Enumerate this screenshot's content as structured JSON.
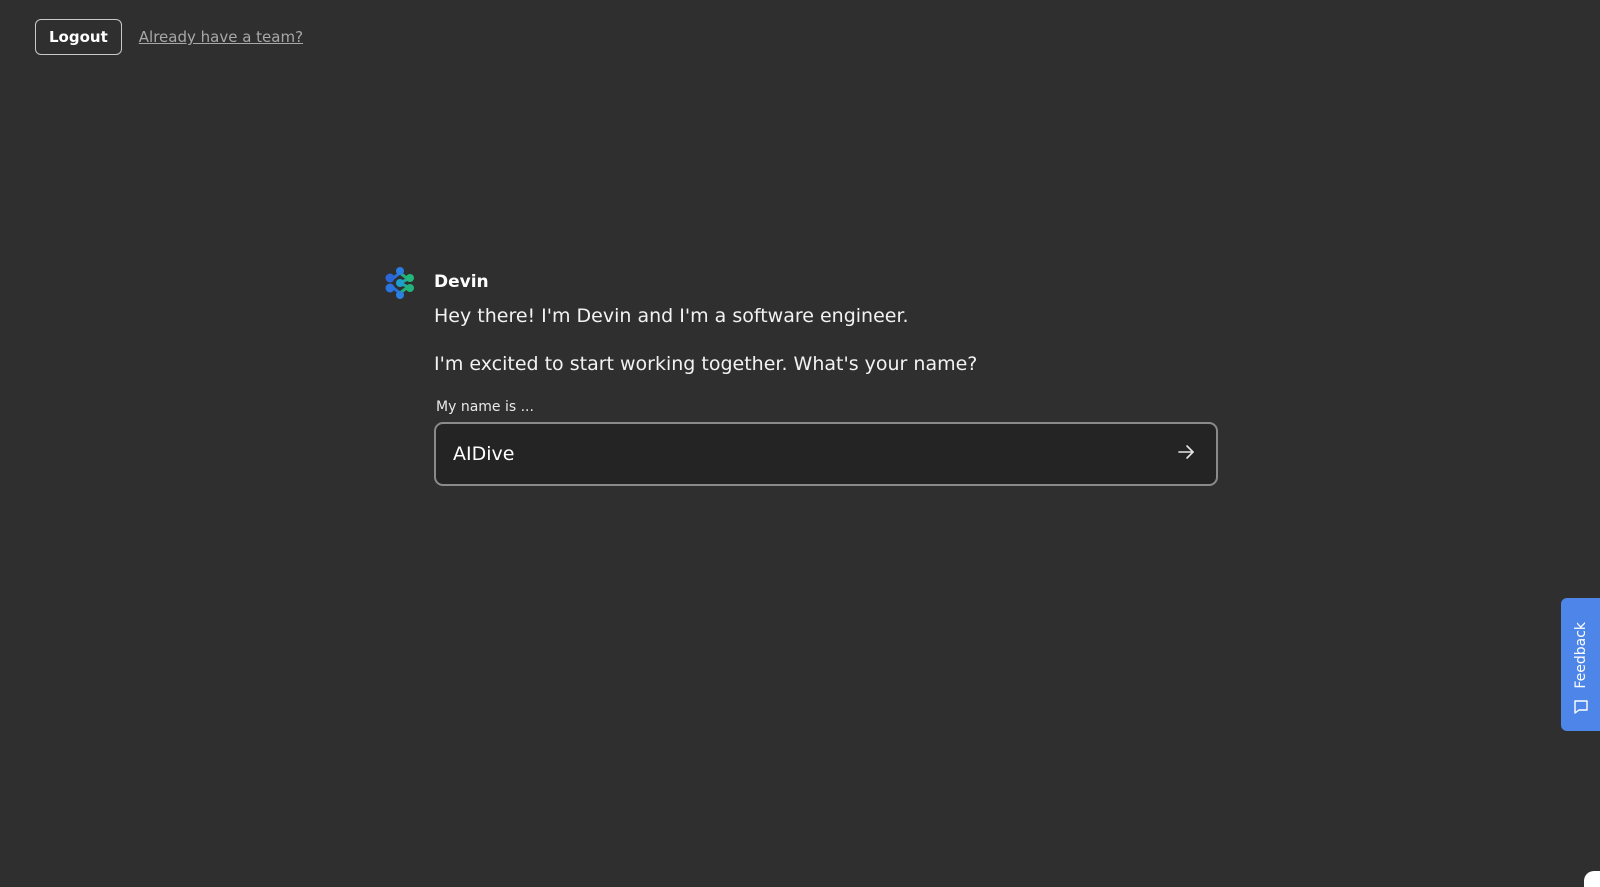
{
  "header": {
    "logout_label": "Logout",
    "team_link_label": "Already have a team?"
  },
  "chat": {
    "sender_name": "Devin",
    "messages": [
      "Hey there! I'm Devin and I'm a software engineer.",
      "I'm excited to start working together. What's your name?"
    ],
    "avatar_icon": "devin-logo-icon"
  },
  "name_form": {
    "label": "My name is ...",
    "value": "AIDive",
    "submit_icon": "arrow-right-icon"
  },
  "feedback": {
    "label": "Feedback",
    "icon": "chat-bubble-icon",
    "color": "#4d86e8"
  },
  "colors": {
    "background": "#2f2f2f",
    "input_background": "#242424",
    "input_border": "#8a8a8a"
  }
}
